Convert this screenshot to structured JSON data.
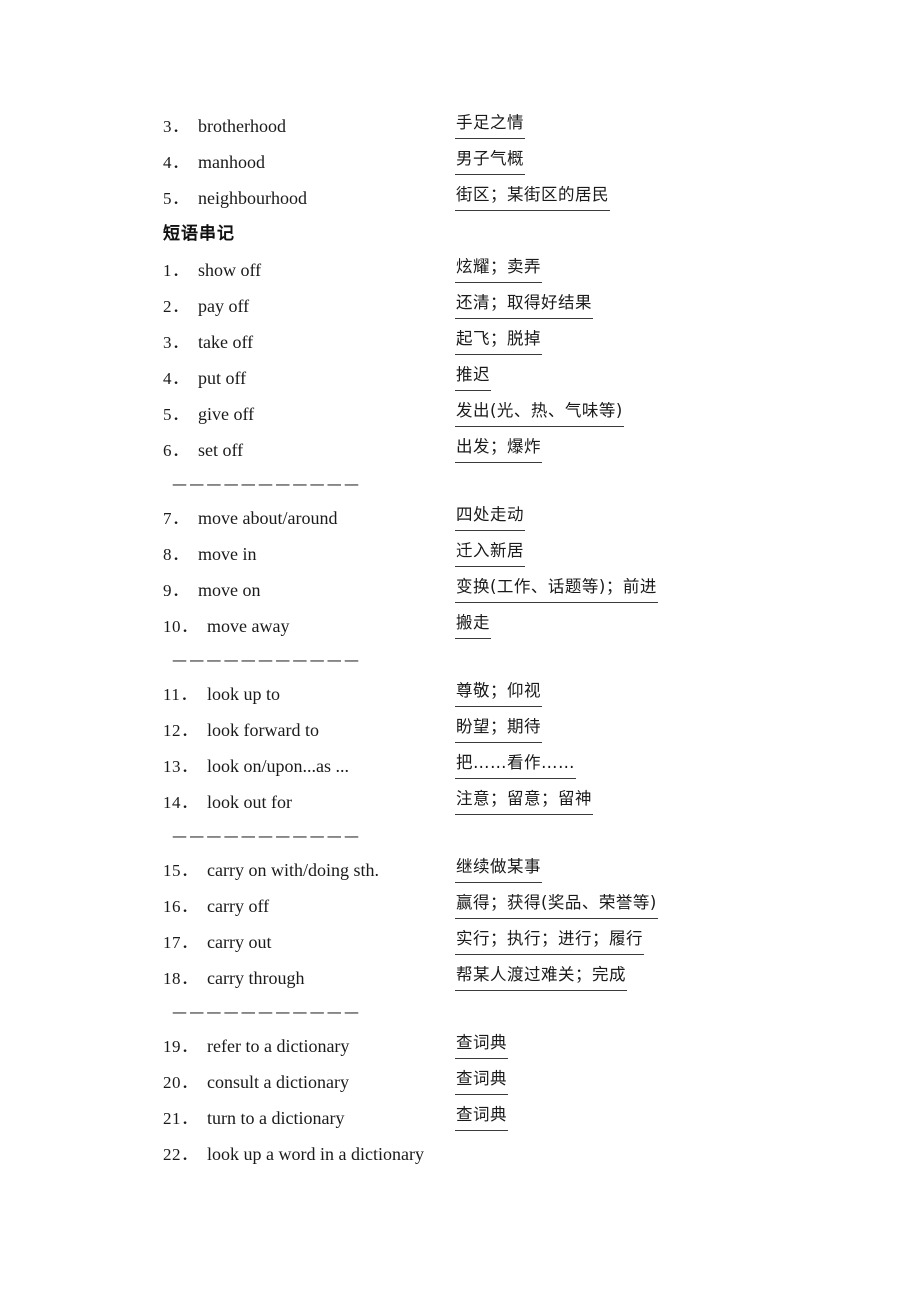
{
  "page": {
    "language": "zh-CN",
    "heading": "短语串记",
    "separator_dashes": "———————————"
  },
  "word_list": [
    {
      "num": "3．",
      "term": "brotherhood",
      "translation": "手足之情"
    },
    {
      "num": "4．",
      "term": "manhood",
      "translation": "男子气概"
    },
    {
      "num": "5．",
      "term": "neighbourhood",
      "translation": "街区；某街区的居民"
    }
  ],
  "phrase_groups": [
    {
      "items": [
        {
          "num": "1．",
          "term": "show off",
          "translation": "炫耀；卖弄"
        },
        {
          "num": "2．",
          "term": "pay off",
          "translation": "还清；取得好结果"
        },
        {
          "num": "3．",
          "term": "take off",
          "translation": "起飞；脱掉"
        },
        {
          "num": "4．",
          "term": "put off",
          "translation": "推迟"
        },
        {
          "num": "5．",
          "term": "give off",
          "translation": "发出(光、热、气味等)"
        },
        {
          "num": "6．",
          "term": "set off",
          "translation": "出发；爆炸"
        }
      ]
    },
    {
      "items": [
        {
          "num": "7．",
          "term": "move about/around",
          "translation": "四处走动"
        },
        {
          "num": "8．",
          "term": "move in",
          "translation": "迁入新居"
        },
        {
          "num": "9．",
          "term": "move on",
          "translation": "变换(工作、话题等)；前进"
        },
        {
          "num": "10．",
          "term": "move away",
          "translation": "搬走"
        }
      ]
    },
    {
      "items": [
        {
          "num": "11．",
          "term": "look up to",
          "translation": "尊敬；仰视"
        },
        {
          "num": "12．",
          "term": "look forward to",
          "translation": "盼望；期待"
        },
        {
          "num": "13．",
          "term": "look on/upon...as ...",
          "translation": "把……看作……"
        },
        {
          "num": "14．",
          "term": "look out for",
          "translation": "注意；留意；留神"
        }
      ]
    },
    {
      "items": [
        {
          "num": "15．",
          "term": "carry on with/doing sth.",
          "translation": "继续做某事"
        },
        {
          "num": "16．",
          "term": "carry off",
          "translation": "赢得；获得(奖品、荣誉等)"
        },
        {
          "num": "17．",
          "term": "carry out",
          "translation": "实行；执行；进行；履行"
        },
        {
          "num": "18．",
          "term": "carry through",
          "translation": "帮某人渡过难关；完成"
        }
      ]
    },
    {
      "items": [
        {
          "num": "19．",
          "term": "refer to a dictionary",
          "translation": "查词典"
        },
        {
          "num": "20．",
          "term": "consult a dictionary",
          "translation": "查词典"
        },
        {
          "num": "21．",
          "term": "turn to a dictionary",
          "translation": "查词典"
        },
        {
          "num": "22．",
          "term": "look up a word in a dictionary",
          "translation": ""
        }
      ]
    }
  ]
}
